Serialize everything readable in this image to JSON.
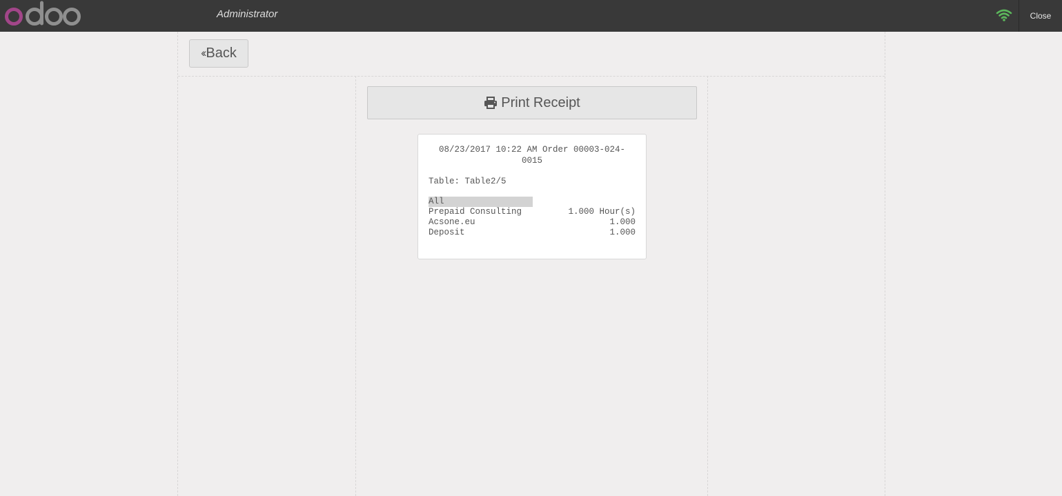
{
  "topbar": {
    "brand": "odoo",
    "user": "Administrator",
    "close_label": "Close",
    "status_color": "#5cb85c"
  },
  "actions": {
    "back_label": "Back",
    "print_label": "Print Receipt"
  },
  "receipt": {
    "header": "08/23/2017 10:22 AM Order 00003-024-0015",
    "table": "Table: Table2/5",
    "category": "All",
    "lines": [
      {
        "name": "Prepaid Consulting",
        "qty": "1.000 Hour(s)"
      },
      {
        "name": "Acsone.eu",
        "qty": "1.000"
      },
      {
        "name": "Deposit",
        "qty": "1.000"
      }
    ]
  },
  "colors": {
    "topbar_bg": "#393939",
    "brand_purple": "#a24689",
    "brand_grey": "#8f8f8f",
    "page_bg": "#f0eeee"
  }
}
